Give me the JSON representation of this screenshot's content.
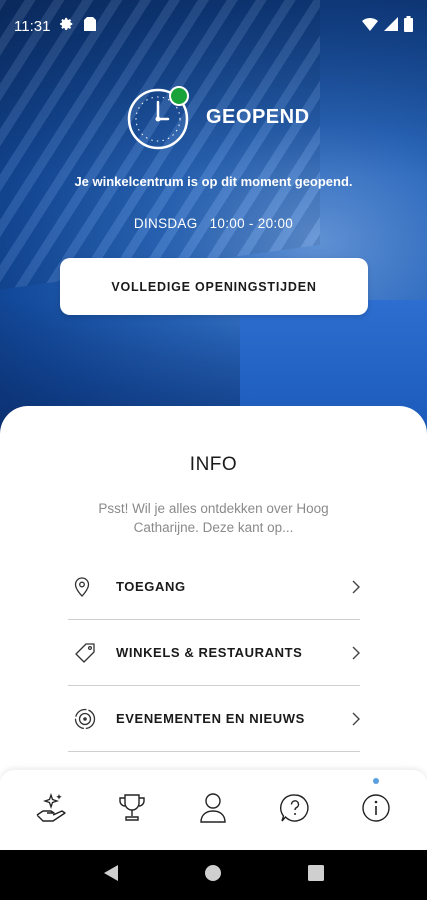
{
  "status_bar": {
    "time": "11:31",
    "icons": [
      "settings-icon",
      "sim-card-icon",
      "wifi-icon",
      "signal-icon",
      "battery-icon"
    ]
  },
  "opening": {
    "title": "GEOPEND",
    "message": "Je winkelcentrum is op dit moment geopend.",
    "day": "DINSDAG",
    "hours": "10:00 - 20:00",
    "button_label": "VOLLEDIGE OPENINGSTIJDEN",
    "status_color": "#1aa23a"
  },
  "info": {
    "title": "INFO",
    "subtitle": "Psst! Wil je alles ontdekken over Hoog Catharijne. Deze kant op...",
    "items": [
      {
        "label": "TOEGANG",
        "icon": "location-pin-icon"
      },
      {
        "label": "WINKELS & RESTAURANTS",
        "icon": "tag-icon"
      },
      {
        "label": "EVENEMENTEN EN NIEUWS",
        "icon": "target-icon"
      }
    ]
  },
  "tabbar": {
    "tabs": [
      {
        "icon": "hand-sparkle-icon",
        "active": false
      },
      {
        "icon": "trophy-icon",
        "active": false
      },
      {
        "icon": "user-icon",
        "active": false
      },
      {
        "icon": "help-icon",
        "active": false
      },
      {
        "icon": "info-icon",
        "active": true
      }
    ],
    "accent_color": "#5a9fe0"
  },
  "nav": {
    "buttons": [
      "back-icon",
      "home-icon",
      "recents-icon"
    ]
  }
}
